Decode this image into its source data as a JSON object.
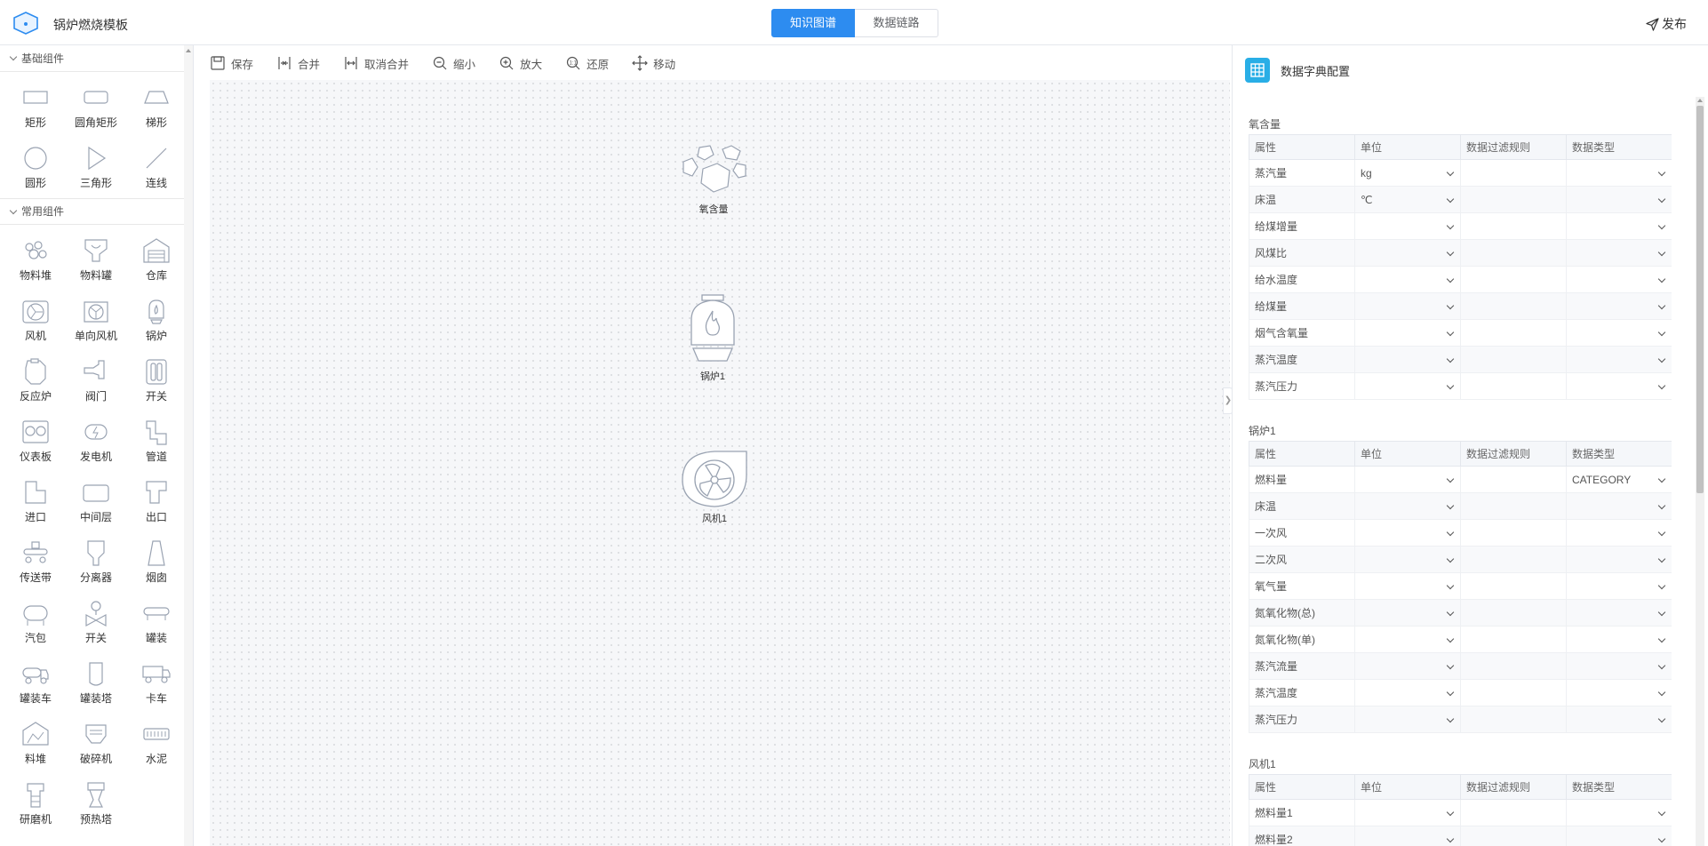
{
  "header": {
    "app_title": "锅炉燃烧模板",
    "tabs": [
      {
        "label": "知识图谱",
        "active": true
      },
      {
        "label": "数据链路",
        "active": false
      }
    ],
    "publish_label": "发布",
    "accent_color": "#2d8cf0"
  },
  "sidebar": {
    "sections": [
      {
        "title": "基础组件",
        "items": [
          {
            "label": "矩形",
            "icon": "rectangle-icon"
          },
          {
            "label": "圆角矩形",
            "icon": "rounded-rectangle-icon"
          },
          {
            "label": "梯形",
            "icon": "trapezoid-icon"
          },
          {
            "label": "圆形",
            "icon": "circle-icon"
          },
          {
            "label": "三角形",
            "icon": "triangle-icon"
          },
          {
            "label": "连线",
            "icon": "line-icon"
          }
        ]
      },
      {
        "title": "常用组件",
        "items": [
          {
            "label": "物料堆",
            "icon": "material-pile-icon"
          },
          {
            "label": "物料罐",
            "icon": "material-tank-icon"
          },
          {
            "label": "仓库",
            "icon": "warehouse-icon"
          },
          {
            "label": "风机",
            "icon": "fan-icon"
          },
          {
            "label": "单向风机",
            "icon": "one-way-fan-icon"
          },
          {
            "label": "锅炉",
            "icon": "boiler-icon"
          },
          {
            "label": "反应炉",
            "icon": "reactor-icon"
          },
          {
            "label": "阀门",
            "icon": "valve-icon"
          },
          {
            "label": "开关",
            "icon": "switch-icon"
          },
          {
            "label": "仪表板",
            "icon": "dashboard-icon"
          },
          {
            "label": "发电机",
            "icon": "generator-icon"
          },
          {
            "label": "管道",
            "icon": "pipe-icon"
          },
          {
            "label": "进口",
            "icon": "inlet-icon"
          },
          {
            "label": "中间层",
            "icon": "middle-layer-icon"
          },
          {
            "label": "出口",
            "icon": "outlet-icon"
          },
          {
            "label": "传送带",
            "icon": "conveyor-icon"
          },
          {
            "label": "分离器",
            "icon": "separator-icon"
          },
          {
            "label": "烟囱",
            "icon": "chimney-icon"
          },
          {
            "label": "汽包",
            "icon": "steam-drum-icon"
          },
          {
            "label": "开关",
            "icon": "switch-valve-icon"
          },
          {
            "label": "罐装",
            "icon": "canning-icon"
          },
          {
            "label": "罐装车",
            "icon": "tank-truck-icon"
          },
          {
            "label": "罐装塔",
            "icon": "tank-tower-icon"
          },
          {
            "label": "卡车",
            "icon": "truck-icon"
          },
          {
            "label": "料堆",
            "icon": "stockpile-icon"
          },
          {
            "label": "破碎机",
            "icon": "crusher-icon"
          },
          {
            "label": "水泥",
            "icon": "cement-icon"
          },
          {
            "label": "研磨机",
            "icon": "grinder-icon"
          },
          {
            "label": "预热塔",
            "icon": "preheater-icon"
          }
        ]
      }
    ]
  },
  "toolbar": {
    "items": [
      {
        "label": "保存",
        "icon": "save-icon"
      },
      {
        "label": "合并",
        "icon": "merge-icon"
      },
      {
        "label": "取消合并",
        "icon": "unmerge-icon"
      },
      {
        "label": "缩小",
        "icon": "zoom-out-icon"
      },
      {
        "label": "放大",
        "icon": "zoom-in-icon"
      },
      {
        "label": "还原",
        "icon": "reset-zoom-icon"
      },
      {
        "label": "移动",
        "icon": "move-icon"
      }
    ]
  },
  "canvas": {
    "nodes": [
      {
        "label": "氧含量",
        "icon": "material-pile-icon"
      },
      {
        "label": "锅炉1",
        "icon": "boiler-icon"
      },
      {
        "label": "风机1",
        "icon": "fan-icon"
      }
    ]
  },
  "panel": {
    "title": "数据字典配置",
    "icon_color": "#29aee6",
    "columns": [
      "属性",
      "单位",
      "数据过滤规则",
      "数据类型"
    ],
    "groups": [
      {
        "title": "氧含量",
        "rows": [
          {
            "attr": "蒸汽量",
            "unit": "kg",
            "filter": "",
            "type": ""
          },
          {
            "attr": "床温",
            "unit": "℃",
            "filter": "",
            "type": ""
          },
          {
            "attr": "给煤增量",
            "unit": "",
            "filter": "",
            "type": ""
          },
          {
            "attr": "风煤比",
            "unit": "",
            "filter": "",
            "type": ""
          },
          {
            "attr": "给水温度",
            "unit": "",
            "filter": "",
            "type": ""
          },
          {
            "attr": "给煤量",
            "unit": "",
            "filter": "",
            "type": ""
          },
          {
            "attr": "烟气含氧量",
            "unit": "",
            "filter": "",
            "type": ""
          },
          {
            "attr": "蒸汽温度",
            "unit": "",
            "filter": "",
            "type": ""
          },
          {
            "attr": "蒸汽压力",
            "unit": "",
            "filter": "",
            "type": ""
          }
        ]
      },
      {
        "title": "锅炉1",
        "rows": [
          {
            "attr": "燃料量",
            "unit": "",
            "filter": "",
            "type": "CATEGORY"
          },
          {
            "attr": "床温",
            "unit": "",
            "filter": "",
            "type": ""
          },
          {
            "attr": "一次风",
            "unit": "",
            "filter": "",
            "type": ""
          },
          {
            "attr": "二次风",
            "unit": "",
            "filter": "",
            "type": ""
          },
          {
            "attr": "氧气量",
            "unit": "",
            "filter": "",
            "type": ""
          },
          {
            "attr": "氮氧化物(总)",
            "unit": "",
            "filter": "",
            "type": ""
          },
          {
            "attr": "氮氧化物(单)",
            "unit": "",
            "filter": "",
            "type": ""
          },
          {
            "attr": "蒸汽流量",
            "unit": "",
            "filter": "",
            "type": ""
          },
          {
            "attr": "蒸汽温度",
            "unit": "",
            "filter": "",
            "type": ""
          },
          {
            "attr": "蒸汽压力",
            "unit": "",
            "filter": "",
            "type": ""
          }
        ]
      },
      {
        "title": "风机1",
        "rows": [
          {
            "attr": "燃料量1",
            "unit": "",
            "filter": "",
            "type": ""
          },
          {
            "attr": "燃料量2",
            "unit": "",
            "filter": "",
            "type": ""
          }
        ]
      }
    ]
  }
}
